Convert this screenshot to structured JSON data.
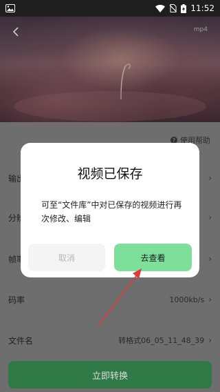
{
  "status_bar": {
    "time": "11:52"
  },
  "video": {
    "format_label": "mp4"
  },
  "help": {
    "label": "使用帮助"
  },
  "settings": [
    {
      "label": "输出",
      "value": ""
    },
    {
      "label": "分辨",
      "value": ""
    },
    {
      "label": "帧率",
      "value": ""
    },
    {
      "label": "码率",
      "value": "1000kb/s"
    },
    {
      "label": "文件名",
      "value": "转格式06_05_11_48_39"
    }
  ],
  "convert_button_label": "立即转换",
  "dialog": {
    "title": "视频已保存",
    "message": "可至“文件库”中对已保存的视频进行再次修改、编辑",
    "cancel_label": "取消",
    "confirm_label": "去查看"
  },
  "colors": {
    "accent": "#7ddf9a",
    "annotation": "#e23b3b"
  }
}
